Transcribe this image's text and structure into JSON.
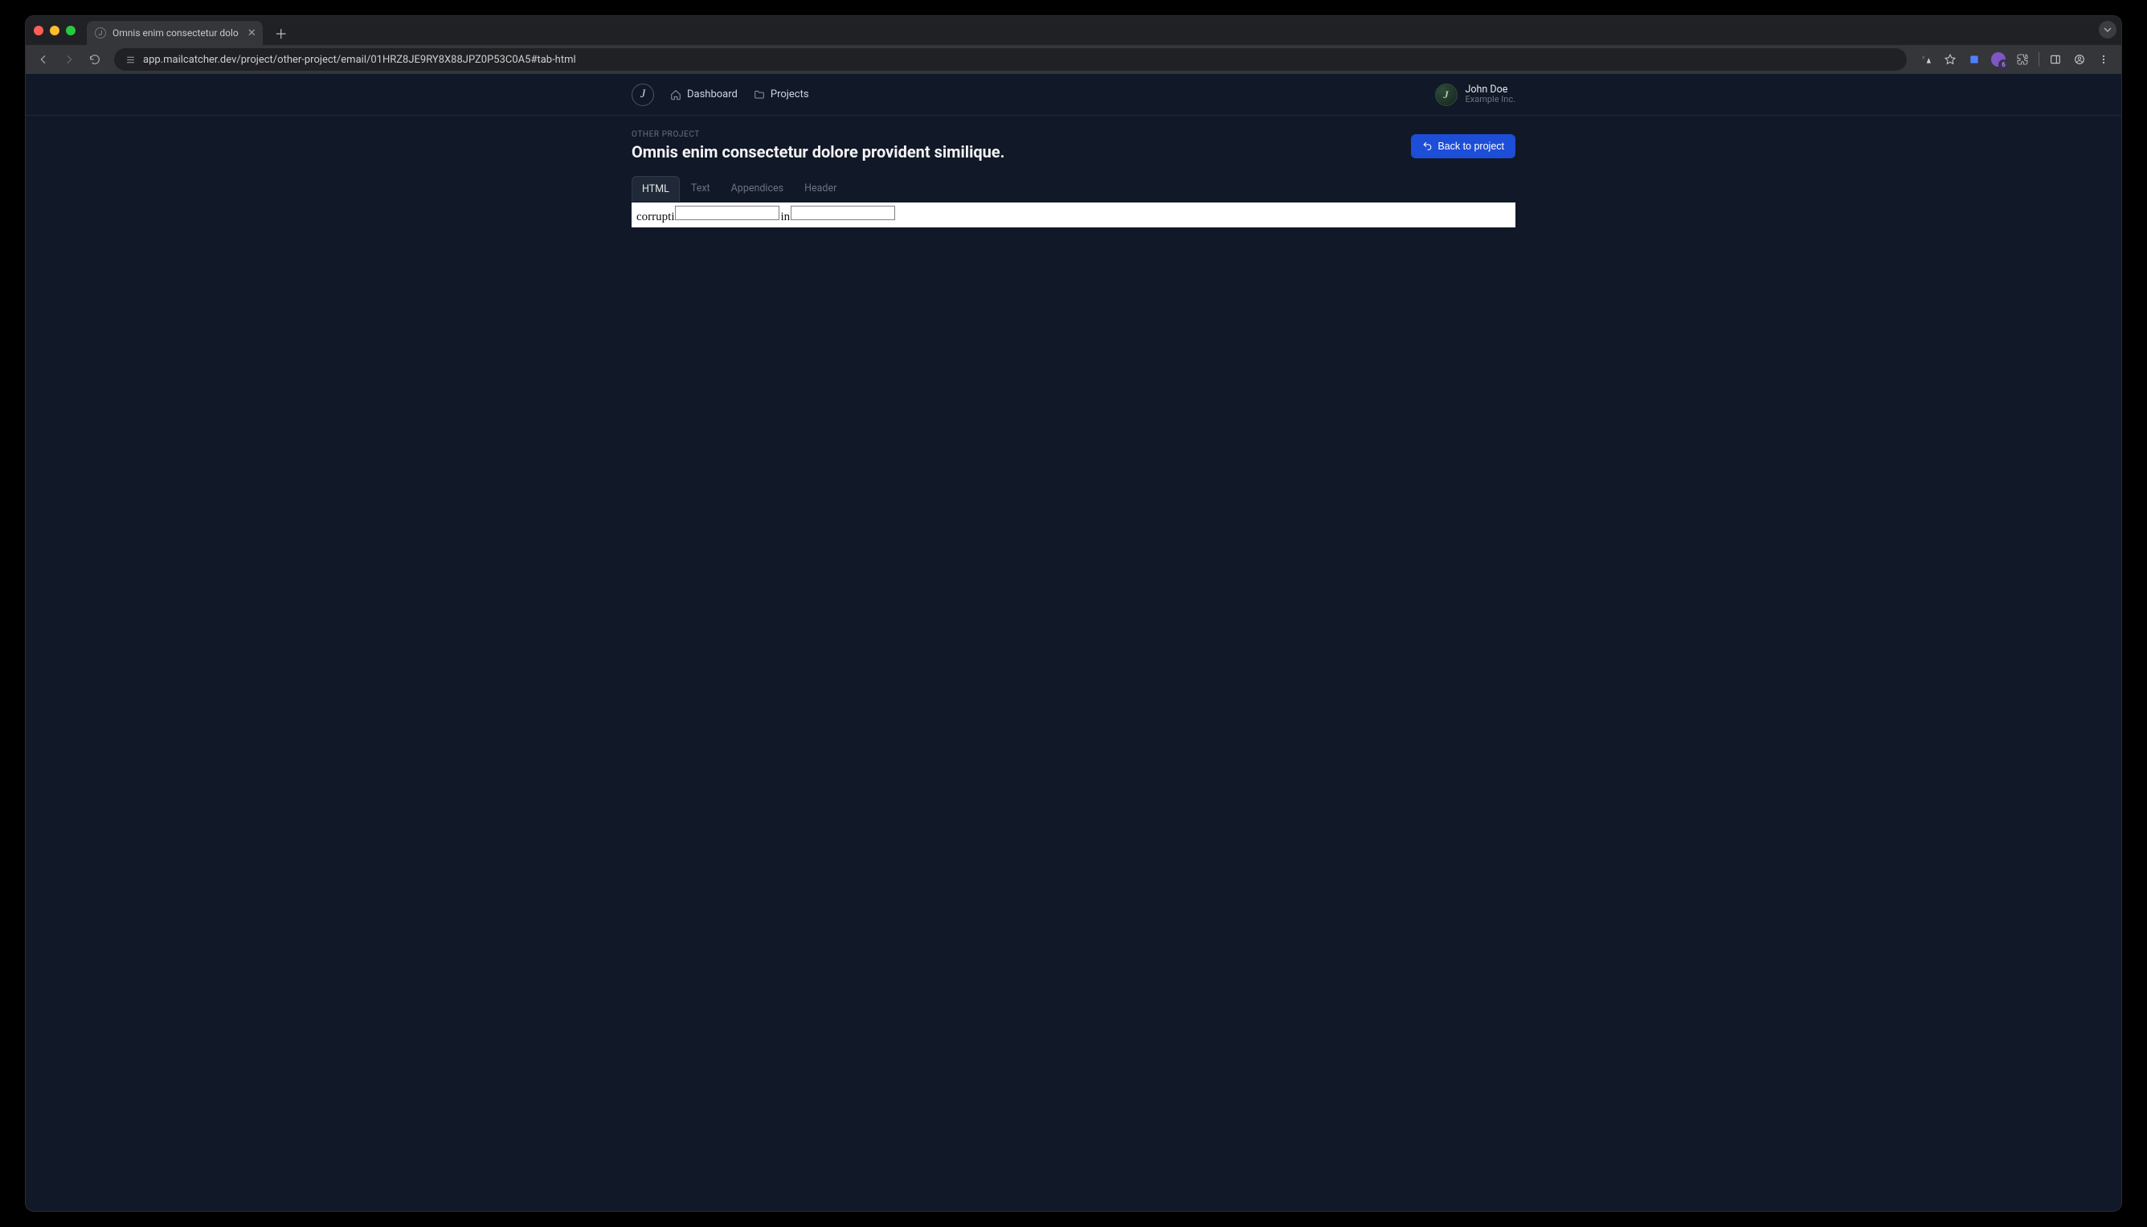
{
  "browser": {
    "tab_title": "Omnis enim consectetur dolo",
    "url_display": "app.mailcatcher.dev/project/other-project/email/01HRZ8JE9RY8X88JPZ0P53C0A5#tab-html",
    "avatar_badge": "6"
  },
  "nav": {
    "brand_letter": "J",
    "dashboard": "Dashboard",
    "projects": "Projects"
  },
  "user": {
    "initial": "J",
    "name": "John Doe",
    "org": "Example Inc."
  },
  "page": {
    "breadcrumb": "OTHER PROJECT",
    "title": "Omnis enim consectetur dolore provident similique.",
    "back_btn": "Back to project"
  },
  "tabs": [
    {
      "label": "HTML",
      "active": true
    },
    {
      "label": "Text",
      "active": false
    },
    {
      "label": "Appendices",
      "active": false
    },
    {
      "label": "Header",
      "active": false
    }
  ],
  "html_body": {
    "before": "corrupti",
    "middle": "in"
  }
}
